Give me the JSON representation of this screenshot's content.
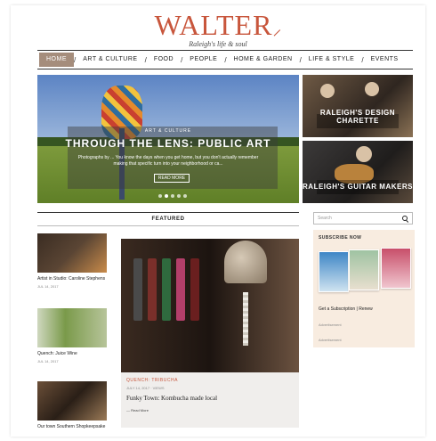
{
  "site": {
    "logo": "WALTER",
    "tagline": "Raleigh's life & soul"
  },
  "nav": {
    "items": [
      "HOME",
      "ART & CULTURE",
      "FOOD",
      "PEOPLE",
      "HOME & GARDEN",
      "LIFE & STYLE",
      "EVENTS"
    ],
    "active": "HOME",
    "separator": "/"
  },
  "hero": {
    "kicker": "ART & CULTURE",
    "title": "THROUGH THE LENS: PUBLIC ART",
    "description": "Photographs by ... You know the days when you get home, but you don't actually remember making that specific turn into your neighborhood or ca...",
    "button": "READ MORE"
  },
  "side_stories": [
    {
      "label": "RALEIGH'S DESIGN CHARETTE"
    },
    {
      "label": "RALEIGH'S GUITAR MAKERS"
    }
  ],
  "featured": {
    "heading": "FEATURED",
    "cards": [
      {
        "title": "Artist in Studio: Caroline Stephens",
        "meta": "JUL 14, 2017"
      },
      {
        "title": "Quench: Juice Wine",
        "meta": "JUL 14, 2017"
      },
      {
        "title": "Our town Southern Shopkeepsake",
        "meta": ""
      }
    ],
    "big_card": {
      "kicker": "QUENCH: TRIBUCHA",
      "meta": "JULY 14, 2017 · VIEWS",
      "title": "Funky Town: Kombucha made local",
      "more": "Read More"
    }
  },
  "sidebar": {
    "search_placeholder": "Search",
    "subscribe_title": "SUBSCRIBE NOW",
    "subscribe_cta": "Get a Subscription | Renew",
    "ad_lines": [
      "Advertisement",
      "Advertisement"
    ]
  },
  "colors": {
    "brand": "#c8563c",
    "nav_active": "#a58d7c",
    "subscribe_bg": "#f8ece0"
  }
}
